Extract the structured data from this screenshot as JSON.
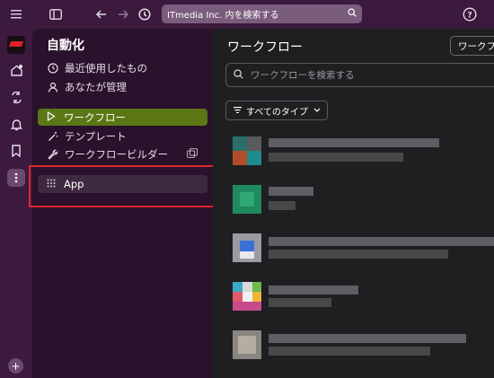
{
  "topbar": {
    "search_placeholder": "ITmedia Inc. 内を検索する",
    "icons": [
      "menu-icon",
      "sidebar-toggle-icon",
      "back-arrow-icon",
      "forward-arrow-icon",
      "history-icon",
      "search-icon",
      "help-icon"
    ]
  },
  "rail": {
    "icons": [
      "workspace-logo",
      "home-icon",
      "threads-icon",
      "activity-bell-icon",
      "bookmark-icon",
      "more-icon",
      "add-icon"
    ]
  },
  "sidebar": {
    "title": "自動化",
    "recent": "最近使用したもの",
    "managed": "あなたが管理",
    "workflows": "ワークフロー",
    "templates": "テンプレート",
    "builder": "ワークフロービルダー",
    "app": "App"
  },
  "main": {
    "title": "ワークフロー",
    "new_button": "ワークフ",
    "search_placeholder": "ワークフローを検索する",
    "type_filter": "すべてのタイプ"
  },
  "colors": {
    "accent_active": "#5b7716",
    "highlight_border": "#e0262f",
    "sidebar_bg": "#2a112c",
    "main_bg": "#1f1f22"
  }
}
